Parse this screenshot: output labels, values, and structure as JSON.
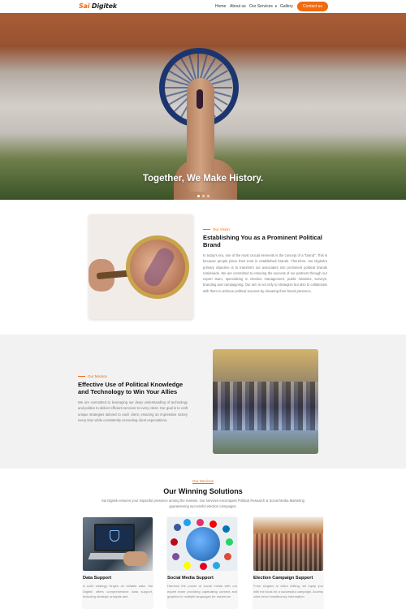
{
  "header": {
    "logo_accent": "Sai",
    "logo_text": "Digitek",
    "nav": [
      "Home",
      "About us",
      "Our Services",
      "Gallery"
    ],
    "contact_label": "Contact us"
  },
  "hero": {
    "title": "Together, We Make History."
  },
  "vision": {
    "eyebrow": "Our Vision",
    "title": "Establishing You as a Prominent Political Brand",
    "body": "In today's era, one of the most crucial elements is the concept of a \"brand\". This is because people place their trust in established brands. Therefore, Sai Digitek's primary objective is to transform our associates into prominent political brands nationwide. We are committed to ensuring the success of our partners through our expert team, specializing in election management, public relations, surveys, branding and campaigning. Our aim is not only to strategize but also to collaborate with them to achieve political success by elevating their brand presence."
  },
  "mission": {
    "eyebrow": "Our Mission",
    "title": "Effective Use of Political Knowledge and Technology to Win Your Allies",
    "body": "We are committed to leveraging our deep understanding of technology and politics to deliver efficient services to every client. Our goal is to craft unique strategies tailored to each client, ensuring an impressive victory every time while consistently exceeding client expectations."
  },
  "services": {
    "eyebrow": "Our Services",
    "title": "Our Winning Solutions",
    "subtitle": "Sai Digitek ensures your impactful presence among the masses. Our services encompass Political Research & Social Media Marketing guaranteeing successful election campaigns.",
    "cards": [
      {
        "title": "Data Support",
        "body": "A solid strategy hinges on reliable data. Sai Digitek offers comprehensive data support, including strategic analysis and"
      },
      {
        "title": "Social Media Support",
        "body": "Harness the power of social media with our expert team providing captivating content and graphics in multiple languages for maximum"
      },
      {
        "title": "Election Campaign Support",
        "body": "From slogans to video editing, we equip you with the tools for a successful campaign. Access voter-level constituency information"
      }
    ]
  },
  "colors": {
    "accent": "#f26b0f",
    "text_dark": "#111111",
    "text_muted": "#7a7a7a",
    "section_alt_bg": "#f2f2f2"
  },
  "hero_slider": {
    "slides": 3,
    "active": 1
  }
}
